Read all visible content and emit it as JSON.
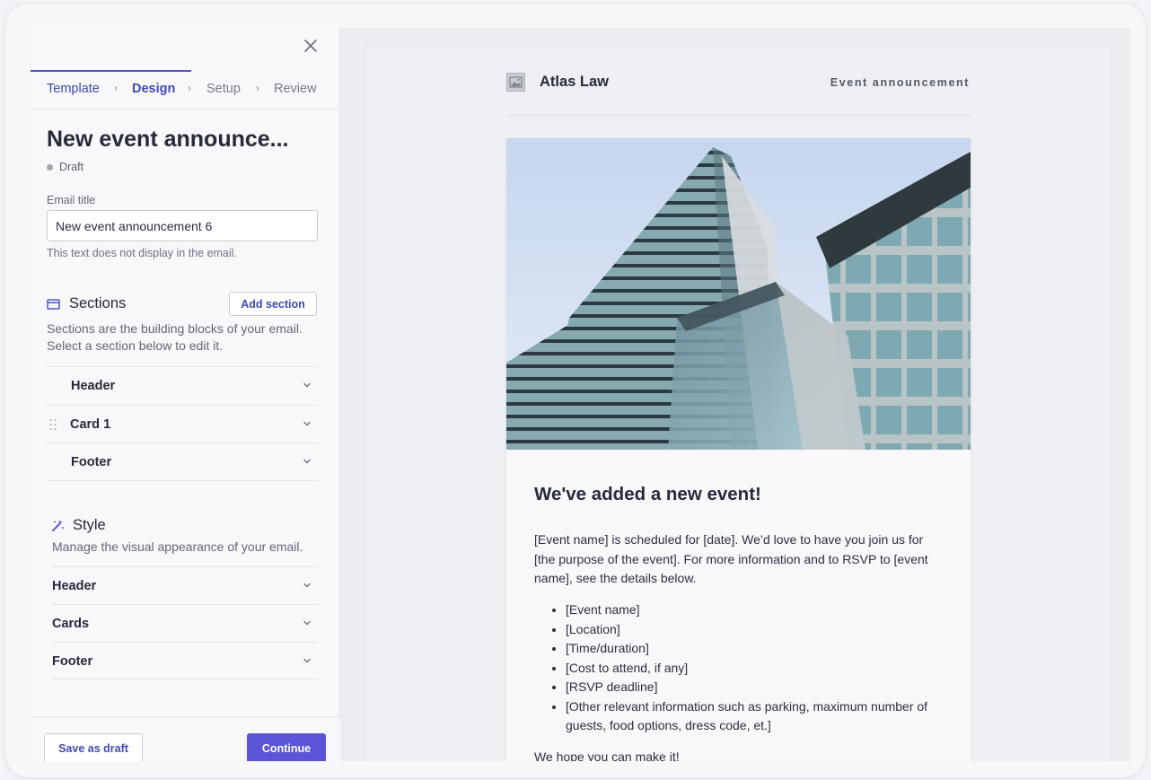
{
  "panel": {
    "steps": [
      {
        "label": "Template",
        "state": "done"
      },
      {
        "label": "Design",
        "state": "current"
      },
      {
        "label": "Setup",
        "state": "upcoming"
      },
      {
        "label": "Review",
        "state": "upcoming"
      }
    ],
    "title": "New event announce...",
    "status": "Draft",
    "email_title": {
      "label": "Email title",
      "value": "New event announcement 6",
      "help": "This text does not display in the email."
    },
    "sections": {
      "heading": "Sections",
      "add_button": "Add section",
      "description": "Sections are the building blocks of your email. Select a section below to edit it.",
      "items": [
        "Header",
        "Card 1",
        "Footer"
      ]
    },
    "style": {
      "heading": "Style",
      "description": "Manage the visual appearance of your email.",
      "items": [
        "Header",
        "Cards",
        "Footer"
      ]
    },
    "footer": {
      "save_draft": "Save as draft",
      "continue": "Continue"
    }
  },
  "preview": {
    "brand_name": "Atlas Law",
    "tag": "Event announcement",
    "card": {
      "title": "We've added a new event!",
      "body": "[Event name] is scheduled for [date]. We’d love to have you join us for [the purpose of the event]. For more information and to RSVP to [event name], see the details below.",
      "list": [
        "[Event name]",
        "[Location]",
        "[Time/duration]",
        "[Cost to attend, if any]",
        "[RSVP deadline]",
        "[Other relevant information such as parking, maximum number of guests, food options, dress code, et.]"
      ],
      "closing": "We hope you can make it!"
    }
  },
  "colors": {
    "accent": "#4b55c9",
    "primary_button": "#5a55d6",
    "text_dark": "#262a3a"
  },
  "icons": {
    "close": "close-icon",
    "sections": "sections-icon",
    "style": "magic-wand-icon",
    "chevron": "chevron-down-icon",
    "drag": "drag-handle-icon",
    "logo": "image-placeholder-icon"
  }
}
